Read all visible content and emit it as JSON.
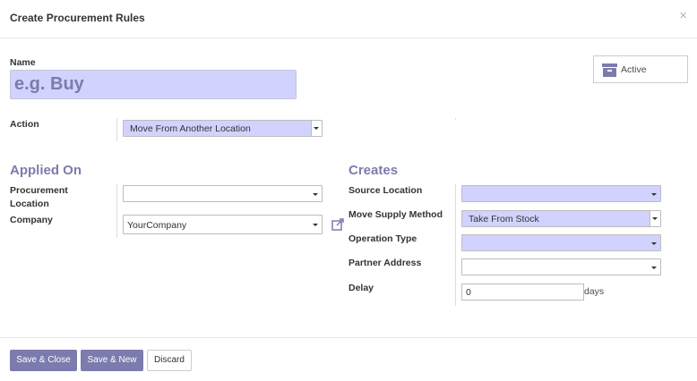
{
  "dialog": {
    "title": "Create Procurement Rules",
    "close_label": "×"
  },
  "form": {
    "name_label": "Name",
    "name_placeholder": "e.g. Buy",
    "name_value": "",
    "active_label": "Active",
    "action_label": "Action",
    "action_value": "Move From Another Location",
    "applied_on": {
      "title": "Applied On",
      "procurement_location_label": "Procurement Location",
      "procurement_location_value": "",
      "company_label": "Company",
      "company_value": "YourCompany"
    },
    "creates": {
      "title": "Creates",
      "source_location_label": "Source Location",
      "source_location_value": "",
      "move_supply_method_label": "Move Supply Method",
      "move_supply_method_value": "Take From Stock",
      "operation_type_label": "Operation Type",
      "operation_type_value": "",
      "partner_address_label": "Partner Address",
      "partner_address_value": "",
      "delay_label": "Delay",
      "delay_value": "0",
      "delay_unit": "days"
    }
  },
  "footer": {
    "save_close_label": "Save & Close",
    "save_new_label": "Save & New",
    "discard_label": "Discard"
  },
  "colors": {
    "accent": "#7c7bad",
    "required_field": "#d2d2ff"
  }
}
